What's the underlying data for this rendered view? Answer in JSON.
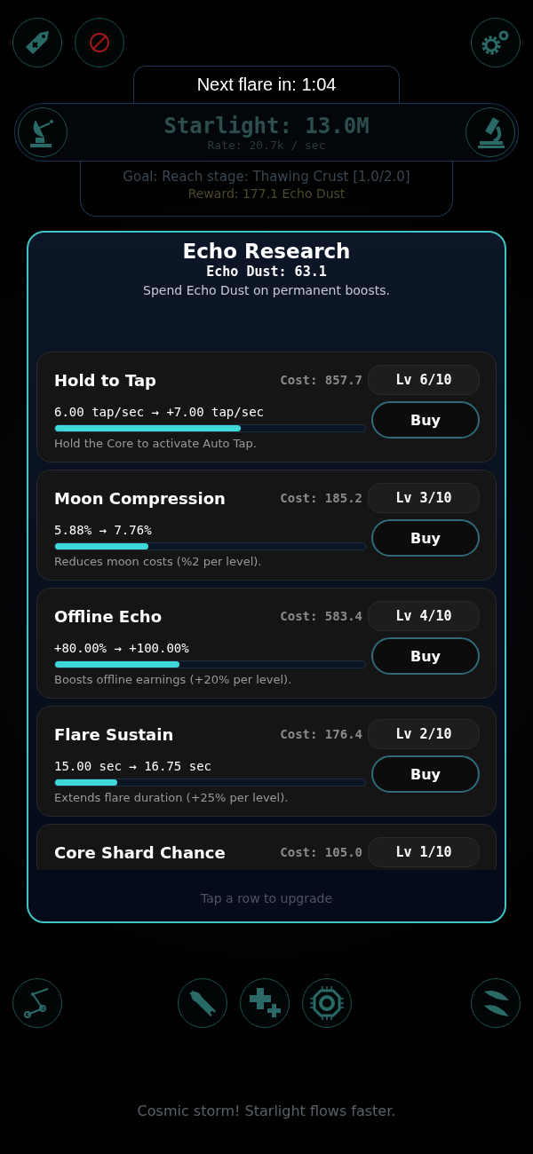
{
  "flare": {
    "text": "Next flare in: 1:04"
  },
  "starlight": {
    "amount": "Starlight: 13.0M",
    "rate": "Rate: 20.7k / sec"
  },
  "goal": {
    "text": "Goal: Reach stage: Thawing Crust [1.0/2.0]",
    "reward": "Reward: 177.1 Echo Dust"
  },
  "research": {
    "title": "Echo Research",
    "dust": "Echo Dust: 63.1",
    "subtitle": "Spend Echo Dust on permanent boosts.",
    "upgrades": [
      {
        "name": "Hold to Tap",
        "cost": "Cost: 857.7",
        "level_label": "Lv 6/10",
        "effect": "6.00 tap/sec → +7.00 tap/sec",
        "level": 0.6,
        "description": "Hold the Core to activate Auto Tap.",
        "buy": "Buy"
      },
      {
        "name": "Moon Compression",
        "cost": "Cost: 185.2",
        "level_label": "Lv 3/10",
        "effect": "5.88% → 7.76%",
        "level": 0.3,
        "description": "Reduces moon costs (%2 per level).",
        "buy": "Buy"
      },
      {
        "name": "Offline Echo",
        "cost": "Cost: 583.4",
        "level_label": "Lv 4/10",
        "effect": "+80.00% → +100.00%",
        "level": 0.4,
        "description": "Boosts offline earnings (+20% per level).",
        "buy": "Buy"
      },
      {
        "name": "Flare Sustain",
        "cost": "Cost: 176.4",
        "level_label": "Lv 2/10",
        "effect": "15.00 sec → 16.75 sec",
        "level": 0.2,
        "description": "Extends flare duration (+25% per level).",
        "buy": "Buy"
      },
      {
        "name": "Core Shard Chance",
        "cost": "Cost: 105.0",
        "level_label": "Lv 1/10"
      }
    ],
    "footer": "Tap a row to upgrade"
  },
  "status_message": "Cosmic storm! Starlight flows faster."
}
